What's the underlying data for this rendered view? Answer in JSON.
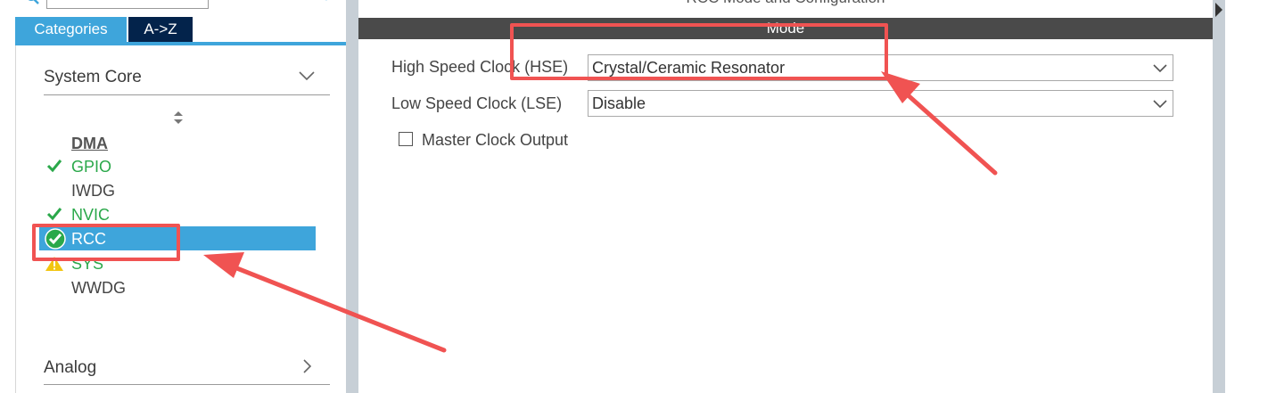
{
  "window": {
    "panel_title": "RCC Mode and Configuration"
  },
  "sidebar": {
    "tabs": [
      {
        "label": "Categories",
        "active": true
      },
      {
        "label": "A->Z",
        "active": false
      }
    ],
    "sections": [
      {
        "title": "System Core",
        "expanded": true
      },
      {
        "title": "Analog",
        "expanded": false
      }
    ],
    "items": [
      {
        "label": "DMA",
        "status": "none"
      },
      {
        "label": "GPIO",
        "status": "ok"
      },
      {
        "label": "IWDG",
        "status": "none"
      },
      {
        "label": "NVIC",
        "status": "ok"
      },
      {
        "label": "RCC",
        "status": "selected-ok"
      },
      {
        "label": "SYS",
        "status": "warning"
      },
      {
        "label": "WWDG",
        "status": "none"
      }
    ]
  },
  "main": {
    "mode_header": "Mode",
    "fields": [
      {
        "label": "High Speed Clock (HSE)",
        "value": "Crystal/Ceramic Resonator"
      },
      {
        "label": "Low Speed Clock (LSE)",
        "value": "Disable"
      }
    ],
    "checkbox": {
      "label": "Master Clock Output",
      "checked": false
    }
  },
  "colors": {
    "accent": "#3ea5db",
    "tab_dark": "#03234b",
    "ok_green": "#2aa84a",
    "warning": "#f2c511",
    "annotation": "#f05352",
    "mode_bar": "#4a4a4a"
  },
  "icons": [
    "search-icon",
    "gear-icon",
    "chevron-down-icon",
    "sort-arrows-icon",
    "check-icon",
    "circle-check-icon",
    "warning-icon",
    "chevron-right-icon",
    "collapse-arrow-icon"
  ]
}
